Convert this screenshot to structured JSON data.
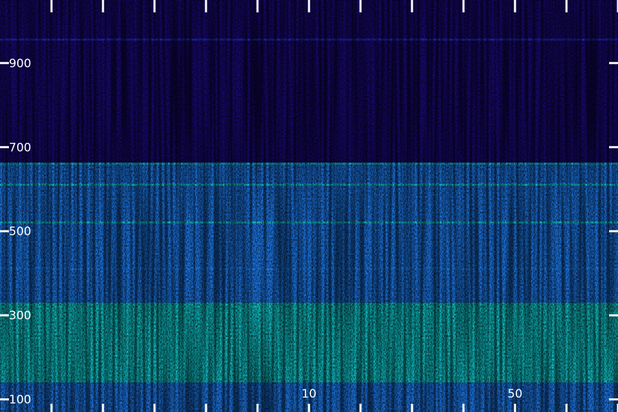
{
  "chart_data": {
    "type": "heatmap",
    "title": "",
    "xlabel": "",
    "ylabel": "",
    "y_ticks": [
      {
        "value": 900,
        "label": "900"
      },
      {
        "value": 700,
        "label": "700"
      },
      {
        "value": 500,
        "label": "500"
      },
      {
        "value": 300,
        "label": "300"
      },
      {
        "value": 100,
        "label": "100"
      }
    ],
    "x_tick_labels": [
      {
        "index": 6,
        "label": "10"
      },
      {
        "index": 10,
        "label": "50"
      }
    ],
    "ylim": [
      70,
      1050
    ],
    "colormap": [
      "#000000",
      "#1a0a7a",
      "#2233d6",
      "#1f88ff",
      "#11e4e0",
      "#7cf53c",
      "#e8ff20"
    ],
    "bands": [
      {
        "from": 1050,
        "to": 660,
        "level": 0.22
      },
      {
        "from": 660,
        "to": 520,
        "level": 0.42
      },
      {
        "from": 520,
        "to": 395,
        "level": 0.48
      },
      {
        "from": 395,
        "to": 330,
        "level": 0.55
      },
      {
        "from": 330,
        "to": 280,
        "level": 0.72
      },
      {
        "from": 280,
        "to": 200,
        "level": 0.62
      },
      {
        "from": 200,
        "to": 140,
        "level": 0.7
      },
      {
        "from": 140,
        "to": 70,
        "level": 0.45
      }
    ],
    "lines": [
      {
        "y": 955,
        "level": 0.4
      },
      {
        "y": 660,
        "level": 0.62
      },
      {
        "y": 610,
        "level": 0.68
      },
      {
        "y": 520,
        "level": 0.72
      },
      {
        "y": 410,
        "level": 0.5
      }
    ],
    "grid": false,
    "legend": "none"
  }
}
